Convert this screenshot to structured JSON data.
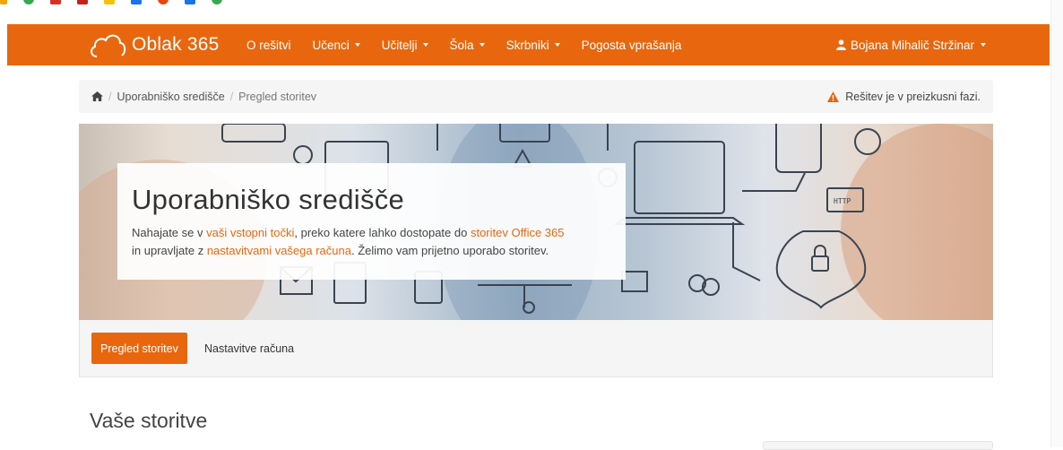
{
  "navbar": {
    "brand": "Oblak 365",
    "items": [
      {
        "label": "O rešitvi",
        "dropdown": false
      },
      {
        "label": "Učenci",
        "dropdown": true
      },
      {
        "label": "Učitelji",
        "dropdown": true
      },
      {
        "label": "Šola",
        "dropdown": true
      },
      {
        "label": "Skrbniki",
        "dropdown": true
      },
      {
        "label": "Pogosta vprašanja",
        "dropdown": false
      }
    ],
    "user": "Bojana Mihalič Stržinar"
  },
  "breadcrumb": {
    "items": [
      "Uporabniško središče",
      "Pregled storitev"
    ],
    "warning": "Rešitev je v preizkusni fazi."
  },
  "hero": {
    "title": "Uporabniško središče",
    "text_1": "Nahajate se v ",
    "link_1": "vaši vstopni točki",
    "text_2": ", preko katere lahko dostopate do ",
    "link_2": "storitev Office 365",
    "text_3": " in upravljate z ",
    "link_3": "nastavitvami vašega računa",
    "text_4": ". Želimo vam prijetno uporabo storitev."
  },
  "tabs": {
    "active": "Pregled storitev",
    "other": "Nastavitve računa"
  },
  "section_title": "Vaše storitve",
  "colors": {
    "accent": "#e8670e",
    "panel": "#f5f5f5"
  }
}
